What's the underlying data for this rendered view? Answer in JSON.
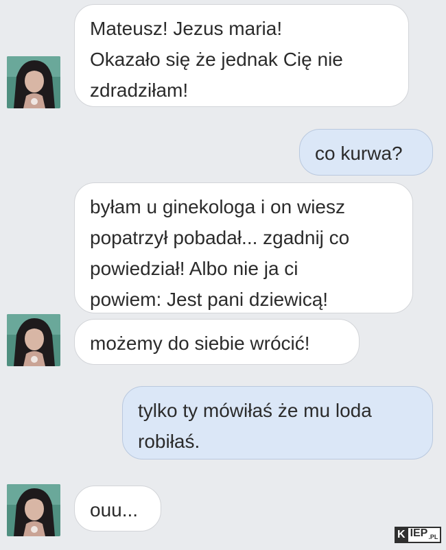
{
  "colors": {
    "background": "#e9ebee",
    "incoming_bubble": "#ffffff",
    "outgoing_bubble": "#dbe7f7",
    "text": "#2b2b2b"
  },
  "messages": [
    {
      "side": "incoming",
      "lines": [
        "Mateusz! Jezus maria!",
        "Okazało się że jednak Cię nie",
        "zdradziłam!"
      ]
    },
    {
      "side": "outgoing",
      "lines": [
        "co kurwa?"
      ]
    },
    {
      "side": "incoming",
      "lines": [
        "byłam u ginekologa i on wiesz",
        "popatrzył pobadał... zgadnij co",
        "powiedział! Albo nie ja ci",
        "powiem: Jest pani dziewicą!"
      ]
    },
    {
      "side": "incoming",
      "lines": [
        "możemy do siebie wrócić!"
      ]
    },
    {
      "side": "outgoing",
      "lines": [
        "tylko ty mówiłaś że mu loda",
        "robiłaś."
      ]
    },
    {
      "side": "incoming",
      "lines": [
        "ouu..."
      ]
    }
  ],
  "avatar": {
    "icon": "contact-avatar-photo"
  },
  "watermark": {
    "k": "K",
    "main": "IEP",
    "suffix": ".PL"
  }
}
